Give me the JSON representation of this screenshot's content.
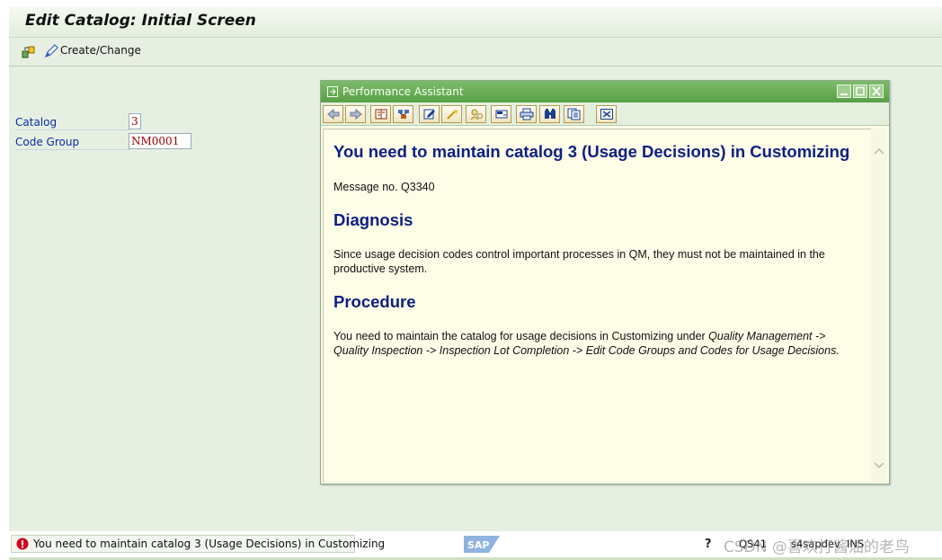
{
  "window": {
    "title": "Edit Catalog: Initial Screen"
  },
  "toolbar": {
    "create_change_label": "Create/Change",
    "icons": [
      "other-object-icon",
      "pencil-icon"
    ]
  },
  "form": {
    "catalog_label": "Catalog",
    "catalog_value": "3",
    "code_group_label": "Code Group",
    "code_group_value": "NM0001"
  },
  "performance_assistant": {
    "title": "Performance Assistant",
    "heading": "You need to maintain catalog 3 (Usage Decisions) in Customizing",
    "message_no": "Message no. Q3340",
    "diagnosis_heading": "Diagnosis",
    "diagnosis_text": "Since usage decision codes control important processes in QM, they must not be maintained in the productive system.",
    "procedure_heading": "Procedure",
    "procedure_text_plain": "You need to maintain the catalog for usage decisions in Customizing under ",
    "procedure_text_path_1": "Quality Management ->",
    "procedure_text_path_2": "Quality Inspection -> Inspection Lot Completion -> Edit Code Groups and Codes for Usage Decisions."
  },
  "status_bar": {
    "message": "You need to maintain catalog 3 (Usage Decisions) in Customizing",
    "system": "QS41",
    "server": "s4sapdev",
    "mode": "INS",
    "watermark": "CSDN @喜欢打酱油的老鸟"
  },
  "colors": {
    "title_green": "#e3eedd",
    "pa_header": "#59a046",
    "pa_heading": "#0d1f82",
    "error_red": "#d0021b",
    "field_label_blue": "#0a2aa8"
  }
}
